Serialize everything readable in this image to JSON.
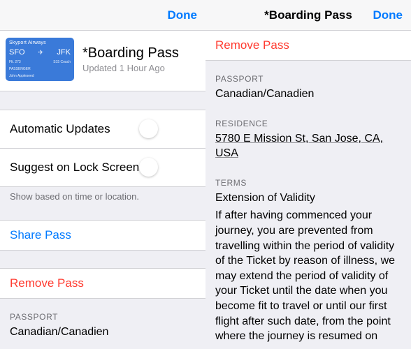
{
  "left": {
    "navbar": {
      "done": "Done"
    },
    "header": {
      "title": "*Boarding Pass",
      "subtitle": "Updated 1 Hour Ago",
      "thumb": {
        "brand": "Skyport Airways",
        "from": "SFO",
        "to": "JFK",
        "sub_left": "Flt. 273",
        "sub_right": "S15   Coach",
        "passenger_label": "PASSENGER",
        "passenger": "John Appleseed"
      }
    },
    "rows": {
      "auto_updates": "Automatic Updates",
      "lock_screen": "Suggest on Lock Screen",
      "foot": "Show based on time or location.",
      "share": "Share Pass",
      "remove": "Remove Pass"
    },
    "passport_label": "PASSPORT",
    "passport_value": "Canadian/Canadien"
  },
  "right": {
    "navbar": {
      "title": "*Boarding Pass",
      "done": "Done"
    },
    "remove": "Remove Pass",
    "passport_label": "PASSPORT",
    "passport_value": "Canadian/Canadien",
    "residence_label": "RESIDENCE",
    "residence_value": "5780 E Mission St, San Jose, CA, USA",
    "terms_label": "TERMS",
    "terms_heading": "Extension of Validity",
    "terms_body": "If after having commenced your journey, you are prevented from travelling within the period of validity of the Ticket by reason of illness, we may extend the period of validity of your Ticket until the date when you become fit to travel or until our first flight after such date, from the point where the journey is resumed on"
  }
}
